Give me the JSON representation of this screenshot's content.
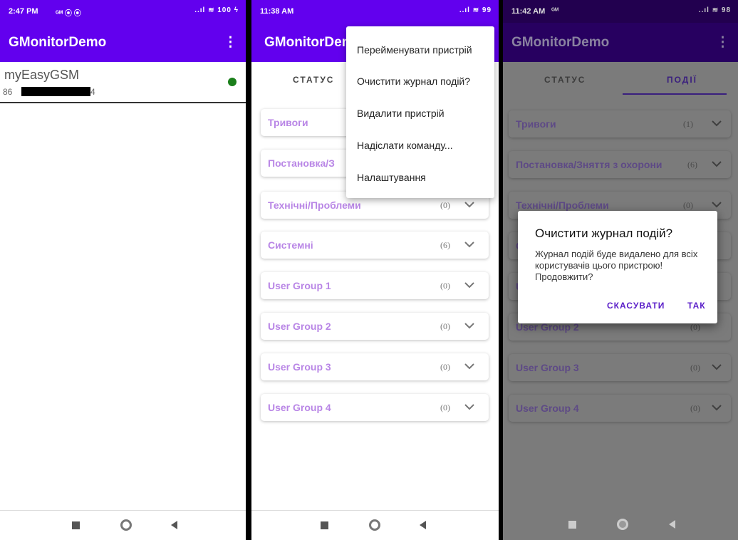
{
  "screen1": {
    "time": "2:47 PM",
    "status_icons_left": "ᴳᴹ ⦿ ⦿",
    "status_icons_right": "..ıl ≋ 100 ϟ",
    "app_title": "GMonitorDemo",
    "menu_glyph": "⋮",
    "device": {
      "name": "myEasyGSM",
      "number_prefix": "86",
      "number_suffix": "4",
      "status_color": "#1b7f1b"
    }
  },
  "screen2": {
    "time": "11:38 AM",
    "status_icons_right": "..ıl ≋ 99",
    "app_title": "GMonitorDem",
    "tabs": [
      {
        "label": "СТАТУС"
      }
    ],
    "categories": [
      {
        "label": "Тривоги"
      },
      {
        "label": "Постановка/З"
      },
      {
        "label": "Технічні/Проблеми",
        "count": "(0)"
      },
      {
        "label": "Системні",
        "count": "(6)"
      },
      {
        "label": "User Group 1",
        "count": "(0)"
      },
      {
        "label": "User Group 2",
        "count": "(0)"
      },
      {
        "label": "User Group 3",
        "count": "(0)"
      },
      {
        "label": "User Group 4",
        "count": "(0)"
      }
    ],
    "menu": [
      {
        "label": "Перейменувати пристрій"
      },
      {
        "label": "Очистити журнал подій?"
      },
      {
        "label": "Видалити пристрій"
      },
      {
        "label": "Надіслати команду..."
      },
      {
        "label": "Налаштування"
      }
    ]
  },
  "screen3": {
    "time": "11:42 AM",
    "status_icons_left": "ᴳᴹ",
    "status_icons_right": "..ıl ≋ 98",
    "app_title": "GMonitorDemo",
    "menu_glyph": "⋮",
    "tabs": [
      {
        "label": "СТАТУС"
      },
      {
        "label": "ПОДІЇ"
      }
    ],
    "categories": [
      {
        "label": "Тривоги",
        "count": "(1)"
      },
      {
        "label": "Постановка/Зняття з охорони",
        "count": "(6)"
      },
      {
        "label": "Технічні/Проблеми",
        "count": "(0)"
      },
      {
        "label": "C"
      },
      {
        "label": "U"
      },
      {
        "label": "User Group 2",
        "count": "(0)"
      },
      {
        "label": "User Group 3",
        "count": "(0)"
      },
      {
        "label": "User Group 4",
        "count": "(0)"
      }
    ],
    "dialog": {
      "title": "Очистити журнал подій?",
      "message": "Журнал подій буде видалено для всіх користувачів цього пристрою! Продовжити?",
      "cancel_label": "СКАСУВАТИ",
      "ok_label": "ТАК"
    }
  },
  "colors": {
    "primary": "#6200ee",
    "category_text": "#b986e6",
    "dialog_button": "#5a1ec8"
  }
}
